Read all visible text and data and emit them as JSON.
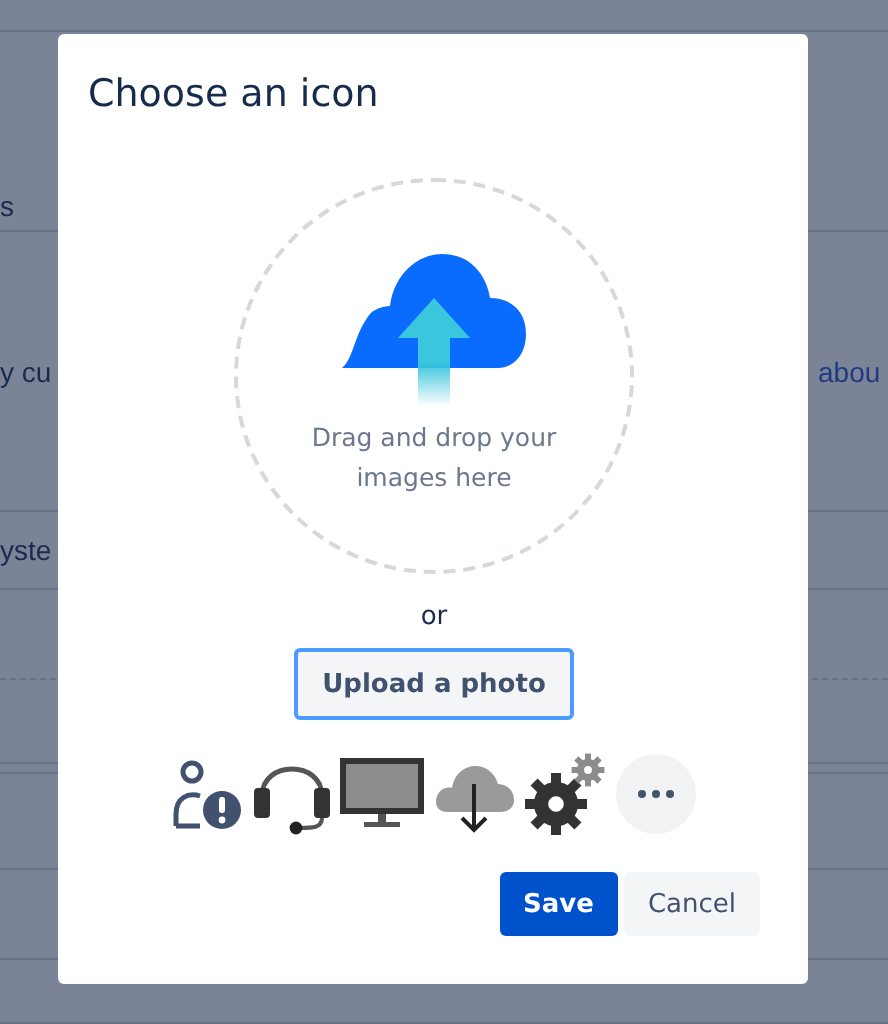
{
  "background_page": {
    "rows": [
      {
        "left": "s"
      },
      {
        "left": "y cu",
        "right": "abou"
      },
      {
        "left": "yste"
      }
    ]
  },
  "dialog": {
    "title": "Choose an icon",
    "dropzone": {
      "text": "Drag and drop your images here"
    },
    "separator": "or",
    "upload_button": "Upload a photo",
    "icon_options": [
      {
        "kind": "user-alert"
      },
      {
        "kind": "headset"
      },
      {
        "kind": "monitor"
      },
      {
        "kind": "cloud-download"
      },
      {
        "kind": "gears"
      },
      {
        "kind": "more"
      }
    ],
    "buttons": [
      {
        "label": "Save",
        "kind": "primary"
      },
      {
        "label": "Cancel",
        "kind": "secondary"
      }
    ]
  }
}
